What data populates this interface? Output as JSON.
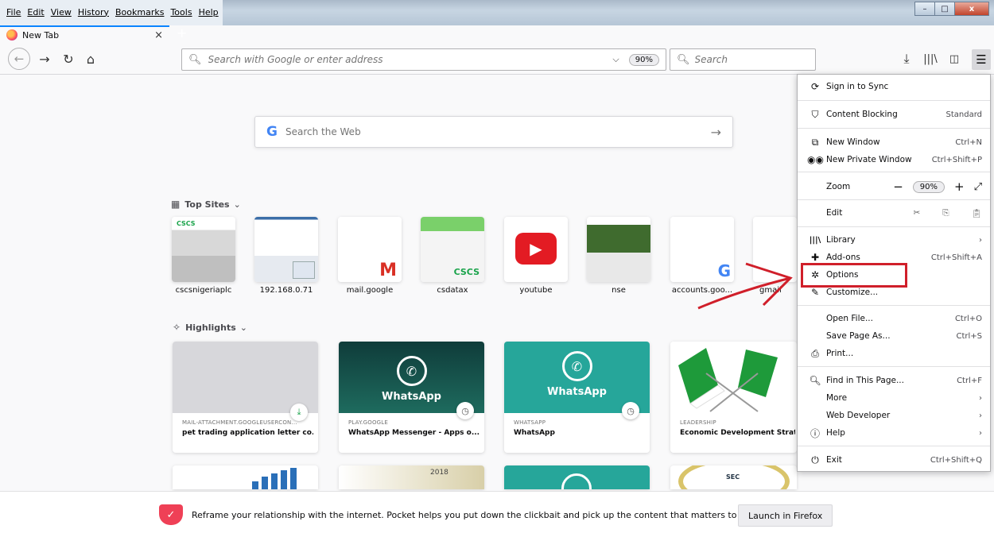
{
  "menubar": [
    "File",
    "Edit",
    "View",
    "History",
    "Bookmarks",
    "Tools",
    "Help"
  ],
  "tab": {
    "title": "New Tab",
    "close": "×",
    "new_tab": "+"
  },
  "window_controls": {
    "minimize": "–",
    "maximize": "□",
    "close": "x"
  },
  "navbar": {
    "url_placeholder": "Search with Google or enter address",
    "zoom": "90%",
    "search_placeholder": "Search"
  },
  "web_search": {
    "placeholder": "Search the Web"
  },
  "top_sites": {
    "title": "Top Sites",
    "items": [
      {
        "label": "cscsnigeriaplc"
      },
      {
        "label": "192.168.0.71"
      },
      {
        "label": "mail.google"
      },
      {
        "label": "csdatax"
      },
      {
        "label": "youtube"
      },
      {
        "label": "nse"
      },
      {
        "label": "accounts.goo..."
      },
      {
        "label": "gmail"
      }
    ]
  },
  "highlights": {
    "title": "Highlights",
    "items": [
      {
        "source": "MAIL-ATTACHMENT.GOOGLEUSERCON...",
        "title": "pet trading application letter co..."
      },
      {
        "source": "PLAY.GOOGLE",
        "title": "WhatsApp Messenger - Apps o...",
        "image_text": "WhatsApp"
      },
      {
        "source": "WHATSAPP",
        "title": "WhatsApp",
        "image_text": "WhatsApp"
      },
      {
        "source": "LEADERSHIP",
        "title": "Economic Development Strateg..."
      }
    ],
    "partial_texts": {
      "calendar": "2018",
      "seal": "SEC"
    }
  },
  "app_menu": {
    "sign_in": "Sign in to Sync",
    "content_blocking": {
      "label": "Content Blocking",
      "value": "Standard"
    },
    "new_window": {
      "label": "New Window",
      "shortcut": "Ctrl+N"
    },
    "new_private_window": {
      "label": "New Private Window",
      "shortcut": "Ctrl+Shift+P"
    },
    "zoom": {
      "label": "Zoom",
      "value": "90%",
      "minus": "−",
      "plus": "+"
    },
    "edit": {
      "label": "Edit"
    },
    "library": {
      "label": "Library"
    },
    "addons": {
      "label": "Add-ons",
      "shortcut": "Ctrl+Shift+A"
    },
    "options": {
      "label": "Options"
    },
    "customize": {
      "label": "Customize..."
    },
    "open_file": {
      "label": "Open File...",
      "shortcut": "Ctrl+O"
    },
    "save_page": {
      "label": "Save Page As...",
      "shortcut": "Ctrl+S"
    },
    "print": {
      "label": "Print..."
    },
    "find": {
      "label": "Find in This Page...",
      "shortcut": "Ctrl+F"
    },
    "more": {
      "label": "More"
    },
    "web_developer": {
      "label": "Web Developer"
    },
    "help": {
      "label": "Help"
    },
    "exit": {
      "label": "Exit",
      "shortcut": "Ctrl+Shift+Q"
    }
  },
  "pocket": {
    "message": "Reframe your relationship with the internet. Pocket helps you put down the clickbait and pick up the content that matters to you.",
    "button": "Launch in Firefox"
  },
  "colors": {
    "accent": "#0a84ff",
    "annotation": "#d01f2a",
    "youtube": "#e31b23",
    "whatsapp_teal": "#26a69a",
    "pocket": "#ef4056"
  }
}
